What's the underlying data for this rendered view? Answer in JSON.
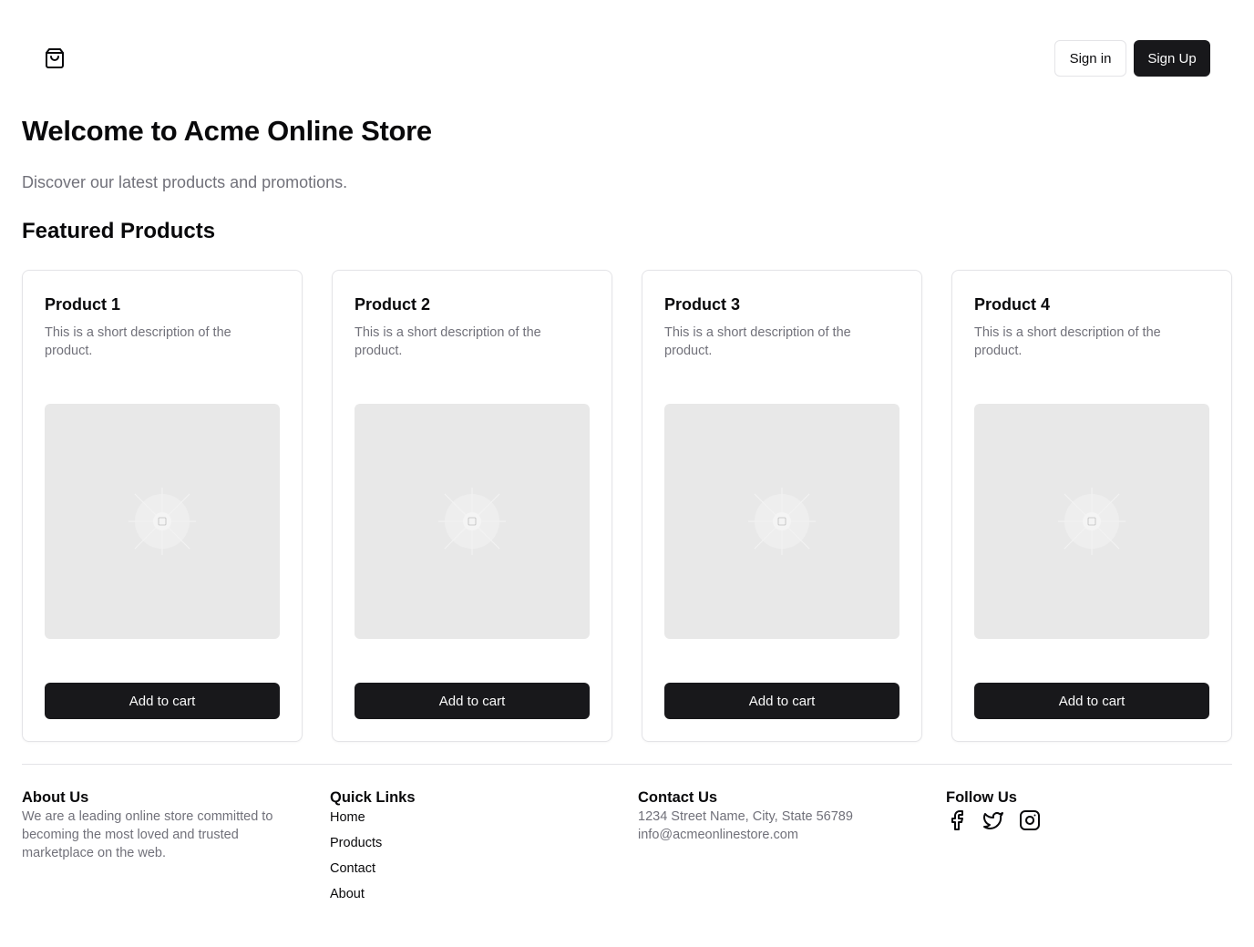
{
  "header": {
    "logo_icon": "shopping-bag-icon",
    "signin_label": "Sign in",
    "signup_label": "Sign Up"
  },
  "hero": {
    "title": "Welcome to Acme Online Store",
    "subtitle": "Discover our latest products and promotions."
  },
  "featured": {
    "title": "Featured Products",
    "products": [
      {
        "name": "Product 1",
        "description": "This is a short description of the product.",
        "button": "Add to cart"
      },
      {
        "name": "Product 2",
        "description": "This is a short description of the product.",
        "button": "Add to cart"
      },
      {
        "name": "Product 3",
        "description": "This is a short description of the product.",
        "button": "Add to cart"
      },
      {
        "name": "Product 4",
        "description": "This is a short description of the product.",
        "button": "Add to cart"
      }
    ]
  },
  "footer": {
    "about": {
      "title": "About Us",
      "text": "We are a leading online store committed to becoming the most loved and trusted marketplace on the web."
    },
    "quick_links": {
      "title": "Quick Links",
      "links": [
        "Home",
        "Products",
        "Contact",
        "About"
      ]
    },
    "contact": {
      "title": "Contact Us",
      "address": "1234 Street Name, City, State 56789",
      "email": "info@acmeonlinestore.com"
    },
    "follow": {
      "title": "Follow Us",
      "icons": [
        "facebook-icon",
        "twitter-icon",
        "instagram-icon"
      ]
    }
  },
  "colors": {
    "primary": "#18181b",
    "muted_text": "#71717a",
    "border": "#e4e4e7",
    "placeholder_bg": "#e8e8e8"
  }
}
